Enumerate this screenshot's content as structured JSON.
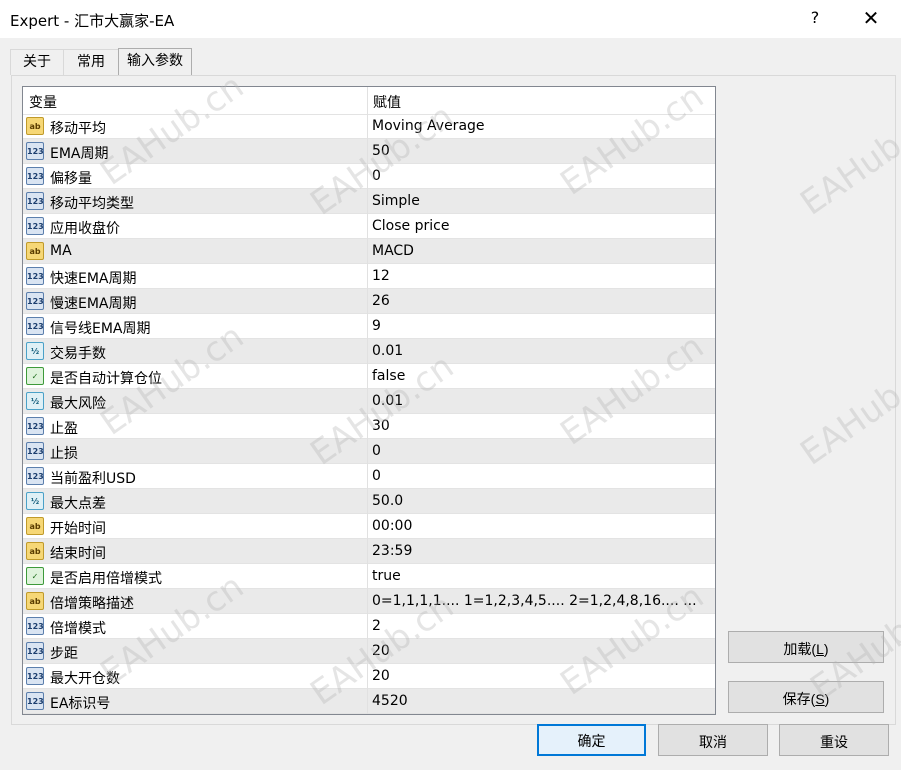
{
  "window": {
    "title": "Expert - 汇市大赢家-EA",
    "help": "?",
    "close": "✕"
  },
  "tabs": [
    {
      "label": "关于"
    },
    {
      "label": "常用"
    },
    {
      "label": "输入参数"
    }
  ],
  "grid": {
    "col_variable": "变量",
    "col_value": "赋值",
    "rows": [
      {
        "icon": "ab",
        "name": "移动平均",
        "value": "Moving Average"
      },
      {
        "icon": "123",
        "name": "EMA周期",
        "value": "50"
      },
      {
        "icon": "123",
        "name": "偏移量",
        "value": "0"
      },
      {
        "icon": "123",
        "name": "移动平均类型",
        "value": "Simple"
      },
      {
        "icon": "123",
        "name": "应用收盘价",
        "value": "Close price"
      },
      {
        "icon": "ab",
        "name": "MA",
        "value": "MACD"
      },
      {
        "icon": "123",
        "name": "快速EMA周期",
        "value": "12"
      },
      {
        "icon": "123",
        "name": "慢速EMA周期",
        "value": "26"
      },
      {
        "icon": "123",
        "name": "信号线EMA周期",
        "value": "9"
      },
      {
        "icon": "frac",
        "name": "交易手数",
        "value": "0.01"
      },
      {
        "icon": "bool",
        "name": "是否自动计算仓位",
        "value": "false"
      },
      {
        "icon": "frac",
        "name": "最大风险",
        "value": "0.01"
      },
      {
        "icon": "123",
        "name": "止盈",
        "value": "30"
      },
      {
        "icon": "123",
        "name": "止损",
        "value": "0"
      },
      {
        "icon": "123",
        "name": "当前盈利USD",
        "value": "0"
      },
      {
        "icon": "frac",
        "name": "最大点差",
        "value": "50.0"
      },
      {
        "icon": "ab",
        "name": "开始时间",
        "value": "00:00"
      },
      {
        "icon": "ab",
        "name": "结束时间",
        "value": "23:59"
      },
      {
        "icon": "bool",
        "name": "是否启用倍增模式",
        "value": "true"
      },
      {
        "icon": "ab",
        "name": "倍增策略描述",
        "value": "0=1,1,1,1....     1=1,2,3,4,5....     2=1,2,4,8,16.... ..."
      },
      {
        "icon": "123",
        "name": "倍增模式",
        "value": "2"
      },
      {
        "icon": "123",
        "name": "步距",
        "value": "20"
      },
      {
        "icon": "123",
        "name": "最大开仓数",
        "value": "20"
      },
      {
        "icon": "123",
        "name": "EA标识号",
        "value": "4520"
      }
    ]
  },
  "buttons": {
    "load_pre": "加载(",
    "load_key": "L",
    "load_post": ")",
    "save_pre": "保存(",
    "save_key": "S",
    "save_post": ")",
    "ok": "确定",
    "cancel": "取消",
    "reset": "重设"
  },
  "watermark": "EAHub.cn",
  "icon_labels": {
    "ab": "ab",
    "123": "123",
    "frac": "½",
    "bool": "✓"
  }
}
